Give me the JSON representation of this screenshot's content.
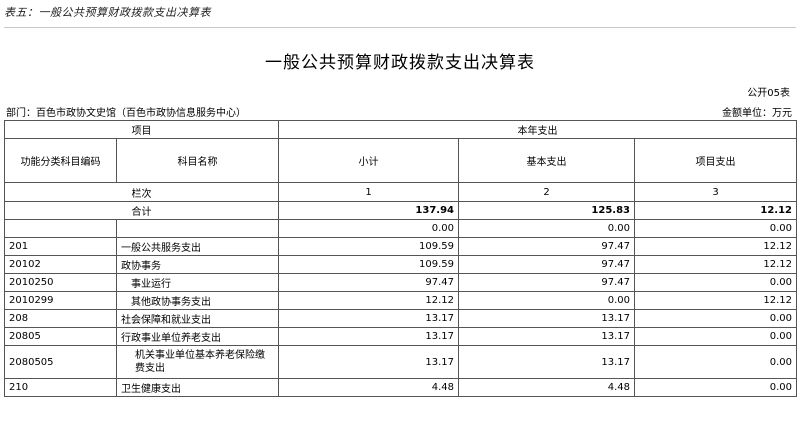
{
  "caption": "表五：一般公共预算财政拨款支出决算表",
  "title": "一般公共预算财政拨款支出决算表",
  "form_no": "公开05表",
  "department": "部门：百色市政协文史馆（百色市政协信息服务中心）",
  "unit": "金额单位：万元",
  "header": {
    "item": "项目",
    "current_year": "本年支出",
    "code": "功能分类科目编码",
    "name": "科目名称",
    "subtotal": "小计",
    "basic": "基本支出",
    "project": "项目支出",
    "col_label": "栏次",
    "col1": "1",
    "col2": "2",
    "col3": "3"
  },
  "total": {
    "label": "合计",
    "subtotal": "137.94",
    "basic": "125.83",
    "project": "12.12"
  },
  "rows": [
    {
      "code": "",
      "name": "",
      "subtotal": "0.00",
      "basic": "0.00",
      "project": "0.00"
    },
    {
      "code": "201",
      "name": "一般公共服务支出",
      "subtotal": "109.59",
      "basic": "97.47",
      "project": "12.12"
    },
    {
      "code": "20102",
      "name": "政协事务",
      "subtotal": "109.59",
      "basic": "97.47",
      "project": "12.12"
    },
    {
      "code": "2010250",
      "name": "事业运行",
      "subtotal": "97.47",
      "basic": "97.47",
      "project": "0.00"
    },
    {
      "code": "2010299",
      "name": "其他政协事务支出",
      "subtotal": "12.12",
      "basic": "0.00",
      "project": "12.12"
    },
    {
      "code": "208",
      "name": "社会保障和就业支出",
      "subtotal": "13.17",
      "basic": "13.17",
      "project": "0.00"
    },
    {
      "code": "20805",
      "name": "行政事业单位养老支出",
      "subtotal": "13.17",
      "basic": "13.17",
      "project": "0.00"
    },
    {
      "code": "2080505",
      "name": "机关事业单位基本养老保险缴费支出",
      "subtotal": "13.17",
      "basic": "13.17",
      "project": "0.00"
    },
    {
      "code": "210",
      "name": "卫生健康支出",
      "subtotal": "4.48",
      "basic": "4.48",
      "project": "0.00"
    }
  ]
}
